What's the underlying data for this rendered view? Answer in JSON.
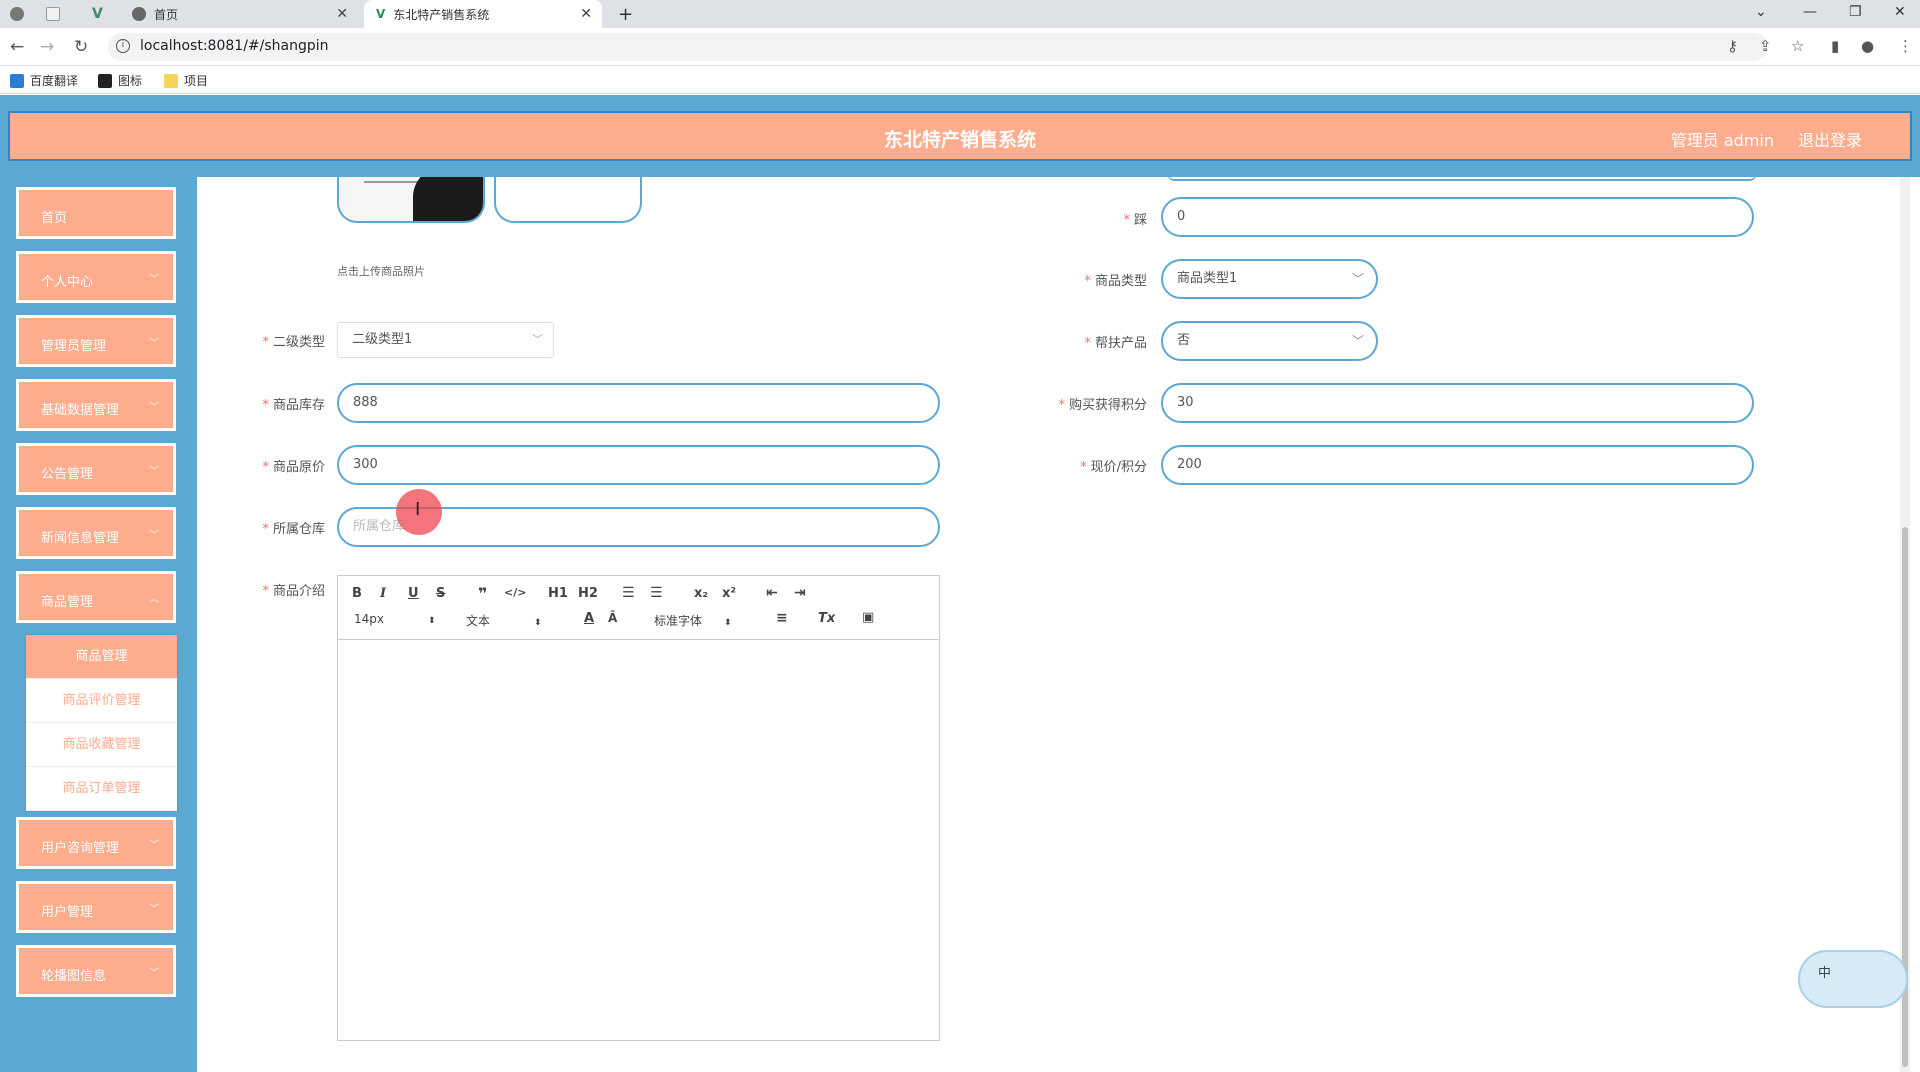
{
  "browser": {
    "tabs": [
      {
        "title": "首页"
      },
      {
        "title": "东北特产销售系统"
      }
    ],
    "url": "localhost:8081/#/shangpin",
    "bookmarks": [
      "百度翻译",
      "图标",
      "项目"
    ]
  },
  "header": {
    "title": "东北特产销售系统",
    "admin": "管理员 admin",
    "logout": "退出登录"
  },
  "sidebar": {
    "items": [
      {
        "label": "首页"
      },
      {
        "label": "个人中心"
      },
      {
        "label": "管理员管理"
      },
      {
        "label": "基础数据管理"
      },
      {
        "label": "公告管理"
      },
      {
        "label": "新闻信息管理"
      },
      {
        "label": "商品管理"
      },
      {
        "label": "用户咨询管理"
      },
      {
        "label": "用户管理"
      },
      {
        "label": "轮播图信息"
      }
    ],
    "submenu": [
      {
        "label": "商品管理"
      },
      {
        "label": "商品评价管理"
      },
      {
        "label": "商品收藏管理"
      },
      {
        "label": "商品订单管理"
      }
    ]
  },
  "form": {
    "upload_hint": "点击上传商品照片",
    "fields": {
      "cai": {
        "label": "踩",
        "value": "0"
      },
      "shangpin_type": {
        "label": "商品类型",
        "value": "商品类型1"
      },
      "erji_type": {
        "label": "二级类型",
        "value": "二级类型1"
      },
      "bangfu": {
        "label": "帮扶产品",
        "value": "否"
      },
      "kucun": {
        "label": "商品库存",
        "value": "888"
      },
      "jifen": {
        "label": "购买获得积分",
        "value": "30"
      },
      "yuanjia": {
        "label": "商品原价",
        "value": "300"
      },
      "xianjia": {
        "label": "现价/积分",
        "value": "200"
      },
      "cangku": {
        "label": "所属仓库",
        "placeholder": "所属仓库"
      },
      "jieshao": {
        "label": "商品介绍"
      }
    },
    "editor": {
      "font_size": "14px",
      "heading": "文本",
      "font_family": "标准字体",
      "h1": "H1",
      "h2": "H2"
    }
  },
  "widget": {
    "label": "中"
  }
}
